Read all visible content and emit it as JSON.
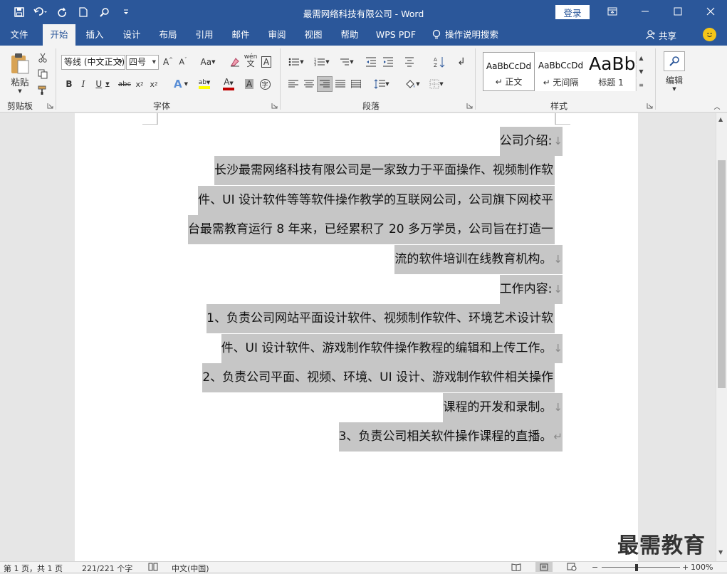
{
  "title": "最需网络科技有限公司 - Word",
  "login_label": "登录",
  "tabs": [
    "文件",
    "开始",
    "插入",
    "设计",
    "布局",
    "引用",
    "邮件",
    "审阅",
    "视图",
    "帮助",
    "WPS PDF",
    "操作说明搜索"
  ],
  "share_label": "共享",
  "clipboard": {
    "paste_label": "粘贴",
    "group_label": "剪贴板"
  },
  "font": {
    "name": "等线 (中文正文)",
    "size": "四号",
    "group_label": "字体"
  },
  "paragraph": {
    "group_label": "段落"
  },
  "styles": {
    "group_label": "样式",
    "items": [
      {
        "preview": "AaBbCcDd",
        "name": "↵ 正文"
      },
      {
        "preview": "AaBbCcDd",
        "name": "↵ 无间隔"
      },
      {
        "preview": "AaBb",
        "name": "标题 1"
      }
    ]
  },
  "editing": {
    "label": "编辑"
  },
  "document": {
    "lines": [
      {
        "text": "公司介绍:",
        "mark": "↓"
      },
      {
        "text": "长沙最需网络科技有限公司是一家致力于平面操作、视频制作软",
        "mark": ""
      },
      {
        "text": "件、UI 设计软件等等软件操作教学的互联网公司，公司旗下网校平",
        "mark": ""
      },
      {
        "text": "台最需教育运行 8 年来，已经累积了 20 多万学员，公司旨在打造一",
        "mark": ""
      },
      {
        "text": "流的软件培训在线教育机构。",
        "mark": "↓"
      },
      {
        "text": "工作内容:",
        "mark": "↓"
      },
      {
        "text": "1、负责公司网站平面设计软件、视频制作软件、环境艺术设计软",
        "mark": ""
      },
      {
        "text": "件、UI 设计软件、游戏制作软件操作教程的编辑和上传工作。",
        "mark": "↓"
      },
      {
        "text": "2、负责公司平面、视频、环境、UI 设计、游戏制作软件相关操作",
        "mark": ""
      },
      {
        "text": "课程的开发和录制。",
        "mark": "↓"
      },
      {
        "text": "3、负责公司相关软件操作课程的直播。",
        "mark": "↵"
      }
    ]
  },
  "watermark": "最需教育",
  "status": {
    "page": "第 1 页，共 1 页",
    "words": "221/221 个字",
    "language": "中文(中国)",
    "zoom": "100%"
  },
  "colors": {
    "accent": "#2b579a",
    "selection": "#c6c6c6",
    "font_color_bar": "#c00000",
    "highlight_bar": "#ffff00"
  }
}
